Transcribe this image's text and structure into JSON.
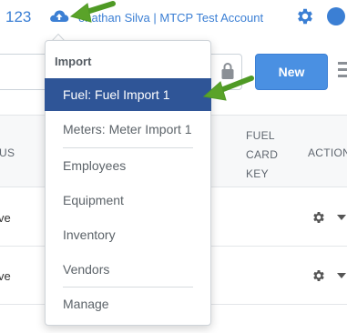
{
  "header": {
    "account_number": "123",
    "user_account": "onathan Silva | MTCP Test Account"
  },
  "toolbar": {
    "new_label": "New"
  },
  "table": {
    "columns": {
      "status": "US",
      "fuel_card_key": [
        "FUEL",
        "CARD",
        "KEY"
      ],
      "actions": "ACTION"
    },
    "rows": [
      {
        "status": "ve"
      },
      {
        "status": "ve"
      }
    ]
  },
  "import_menu": {
    "header": "Import",
    "items": [
      {
        "label": "Fuel: Fuel Import 1",
        "active": true
      },
      {
        "label": "Meters: Meter Import 1",
        "active": false
      },
      {
        "label": "Employees",
        "active": false
      },
      {
        "label": "Equipment",
        "active": false
      },
      {
        "label": "Inventory",
        "active": false
      },
      {
        "label": "Vendors",
        "active": false
      },
      {
        "label": "Manage",
        "active": false
      }
    ]
  },
  "colors": {
    "link_blue": "#3b7fd4",
    "button_blue": "#4a90e2",
    "active_item": "#2f5597",
    "annotation_arrow": "#5aa329"
  }
}
